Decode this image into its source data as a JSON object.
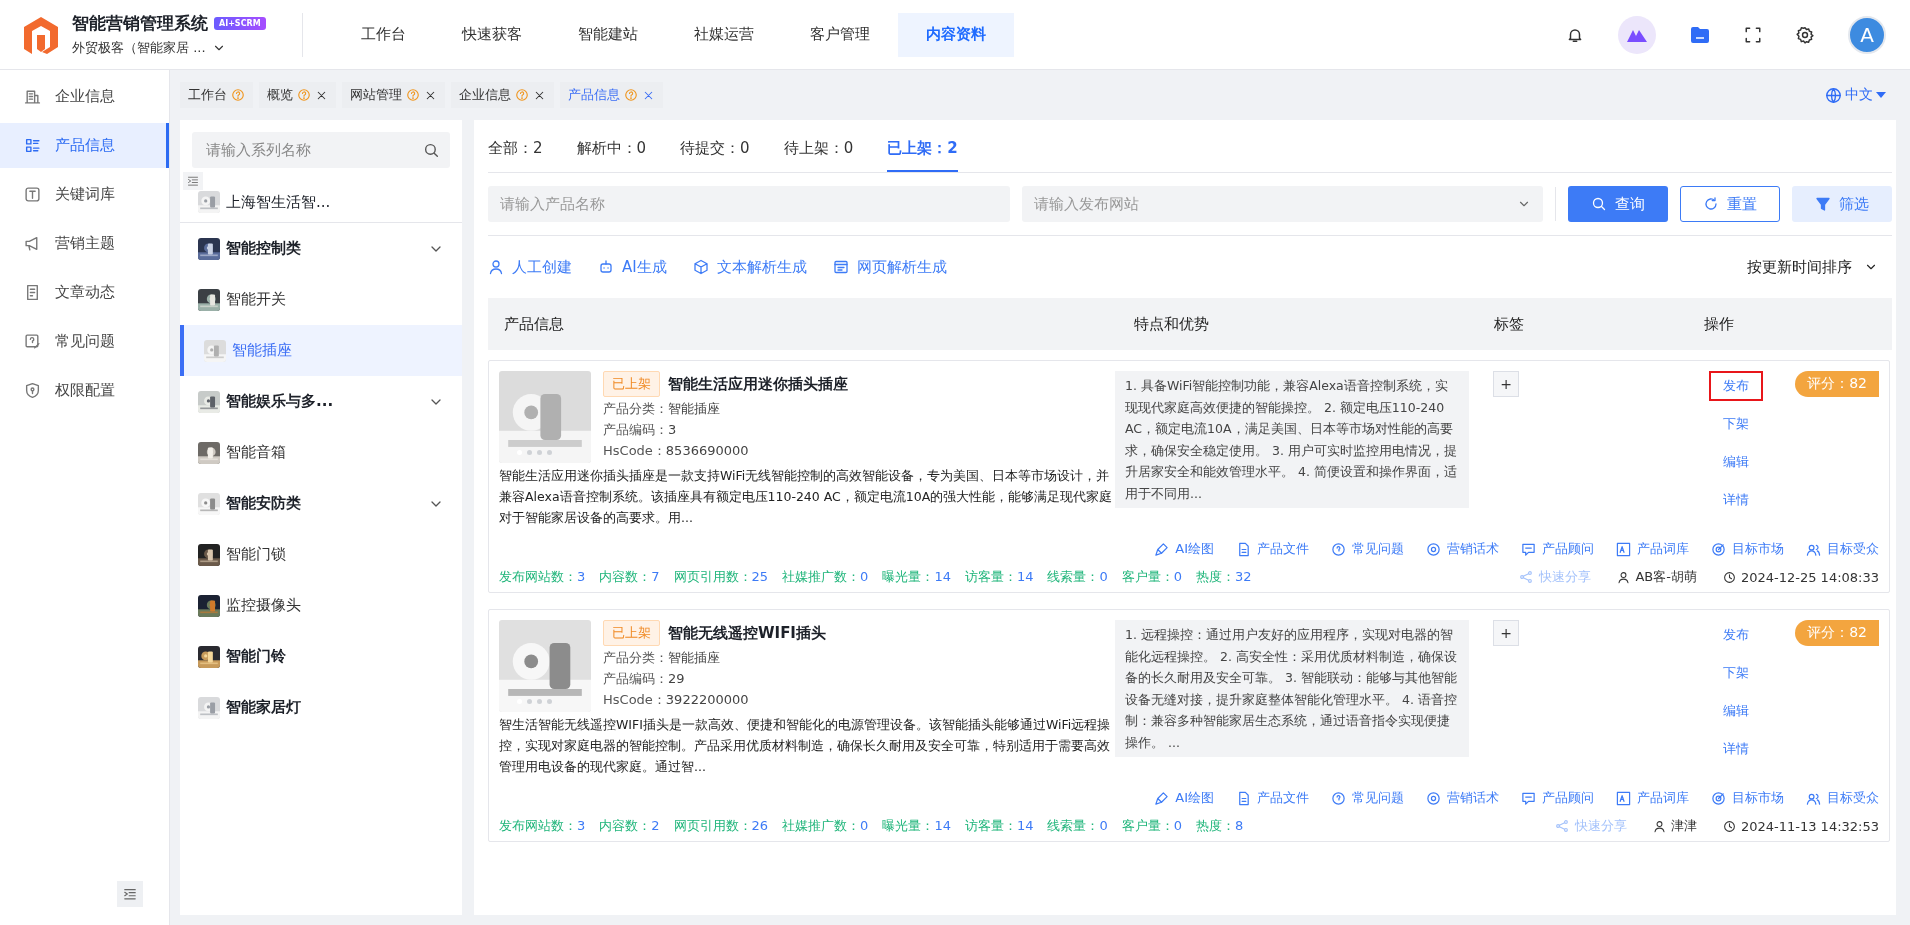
{
  "app": {
    "title": "智能营销管理系统",
    "badge": "AI+SCRM",
    "org": "外贸极客（智能家居 ...",
    "avatar": "A"
  },
  "top_nav": [
    {
      "label": "工作台",
      "selected": false
    },
    {
      "label": "快速获客",
      "selected": false
    },
    {
      "label": "智能建站",
      "selected": false
    },
    {
      "label": "社媒运营",
      "selected": false
    },
    {
      "label": "客户管理",
      "selected": false
    },
    {
      "label": "内容资料",
      "selected": true
    }
  ],
  "side_nav": [
    {
      "label": "企业信息",
      "selected": false
    },
    {
      "label": "产品信息",
      "selected": true
    },
    {
      "label": "关键词库",
      "selected": false
    },
    {
      "label": "营销主题",
      "selected": false
    },
    {
      "label": "文章动态",
      "selected": false
    },
    {
      "label": "常见问题",
      "selected": false
    },
    {
      "label": "权限配置",
      "selected": false
    }
  ],
  "page_tabs": [
    {
      "label": "工作台",
      "closable": false,
      "selected": false
    },
    {
      "label": "概览",
      "closable": true,
      "selected": false
    },
    {
      "label": "网站管理",
      "closable": true,
      "selected": false
    },
    {
      "label": "企业信息",
      "closable": true,
      "selected": false
    },
    {
      "label": "产品信息",
      "closable": true,
      "selected": true
    }
  ],
  "language": "中文",
  "category_panel": {
    "search_placeholder": "请输入系列名称",
    "company": "上海智生活智...",
    "items": [
      {
        "label": "智能控制类",
        "expanded": true,
        "children": [
          {
            "label": "智能开关",
            "selected": false
          },
          {
            "label": "智能插座",
            "selected": true
          }
        ]
      },
      {
        "label": "智能娱乐与多...",
        "expanded": true,
        "children": [
          {
            "label": "智能音箱",
            "selected": false
          }
        ]
      },
      {
        "label": "智能安防类",
        "expanded": true,
        "children": [
          {
            "label": "智能门锁",
            "selected": false
          },
          {
            "label": "监控摄像头",
            "selected": false
          }
        ]
      },
      {
        "label": "智能门铃"
      },
      {
        "label": "智能家居灯"
      }
    ]
  },
  "status_tabs": [
    {
      "label": "全部：2",
      "selected": false
    },
    {
      "label": "解析中：0",
      "selected": false
    },
    {
      "label": "待提交：0",
      "selected": false
    },
    {
      "label": "待上架：0",
      "selected": false
    },
    {
      "label": "已上架：2",
      "selected": true
    }
  ],
  "filters": {
    "name_placeholder": "请输入产品名称",
    "site_placeholder": "请输入发布网站",
    "buttons": [
      {
        "label": "查询",
        "kind": "primary"
      },
      {
        "label": "重置",
        "kind": "outline"
      },
      {
        "label": "筛选",
        "kind": "light"
      }
    ]
  },
  "create_actions": [
    "人工创建",
    "AI生成",
    "文本解析生成",
    "网页解析生成"
  ],
  "sort": "按更新时间排序",
  "table": {
    "columns": [
      "产品信息",
      "特点和优势",
      "标签",
      "操作"
    ],
    "rows": [
      {
        "status": "已上架",
        "name": "智能生活应用迷你插头插座",
        "fields": [
          {
            "label": "产品分类：",
            "value": "智能插座"
          },
          {
            "label": "产品编码：",
            "value": "3"
          },
          {
            "label": "HsCode：",
            "value": "8536690000"
          }
        ],
        "description": "智能生活应用迷你插头插座是一款支持WiFi无线智能控制的高效智能设备，专为美国、日本等市场设计，并兼容Alexa语音控制系统。该插座具有额定电压110-240 AC，额定电流10A的强大性能，能够满足现代家庭对于智能家居设备的高要求。用...",
        "features": "1. 具备WiFi智能控制功能，兼容Alexa语音控制系统，实现现代家庭高效便捷的智能操控。 2. 额定电压110-240 AC，额定电流10A，满足美国、日本等市场对性能的高要求，确保安全稳定使用。 3. 用户可实时监控用电情况，提升居家安全和能效管理水平。 4. 简便设置和操作界面，适用于不同用...",
        "tag_button": "+",
        "actions": [
          {
            "label": "发布",
            "highlighted": true
          },
          {
            "label": "下架",
            "highlighted": false
          },
          {
            "label": "编辑",
            "highlighted": false
          },
          {
            "label": "详情",
            "highlighted": false
          }
        ],
        "score": "评分：82",
        "tools": [
          "AI绘图",
          "产品文件",
          "常见问题",
          "营销话术",
          "产品顾问",
          "产品词库",
          "目标市场",
          "目标受众"
        ],
        "stats": [
          {
            "label": "发布网站数：",
            "value": "3"
          },
          {
            "label": "内容数：",
            "value": "7"
          },
          {
            "label": "网页引用数：",
            "value": "25"
          },
          {
            "label": "社媒推广数：",
            "value": "0"
          },
          {
            "label": "曝光量：",
            "value": "14"
          },
          {
            "label": "访客量：",
            "value": "14"
          },
          {
            "label": "线索量：",
            "value": "0"
          },
          {
            "label": "客户量：",
            "value": "0"
          },
          {
            "label": "热度：",
            "value": "32"
          }
        ],
        "share": "快速分享",
        "owner": "AB客-胡萌",
        "time": "2024-12-25 14:08:33"
      },
      {
        "status": "已上架",
        "name": "智能无线遥控WIFI插头",
        "fields": [
          {
            "label": "产品分类：",
            "value": "智能插座"
          },
          {
            "label": "产品编码：",
            "value": "29"
          },
          {
            "label": "HsCode：",
            "value": "3922200000"
          }
        ],
        "description": "智生活智能无线遥控WIFI插头是一款高效、便捷和智能化的电源管理设备。该智能插头能够通过WiFi远程操控，实现对家庭电器的智能控制。产品采用优质材料制造，确保长久耐用及安全可靠，特别适用于需要高效管理用电设备的现代家庭。通过智...",
        "features": "1. 远程操控：通过用户友好的应用程序，实现对电器的智能化远程操控。 2. 高安全性：采用优质材料制造，确保设备的长久耐用及安全可靠。 3. 智能联动：能够与其他智能设备无缝对接，提升家庭整体智能化管理水平。 4. 语音控制：兼容多种智能家居生态系统，通过语音指令实现便捷操作。 ...",
        "tag_button": "+",
        "actions": [
          {
            "label": "发布",
            "highlighted": false
          },
          {
            "label": "下架",
            "highlighted": false
          },
          {
            "label": "编辑",
            "highlighted": false
          },
          {
            "label": "详情",
            "highlighted": false
          }
        ],
        "score": "评分：82",
        "tools": [
          "AI绘图",
          "产品文件",
          "常见问题",
          "营销话术",
          "产品顾问",
          "产品词库",
          "目标市场",
          "目标受众"
        ],
        "stats": [
          {
            "label": "发布网站数：",
            "value": "3"
          },
          {
            "label": "内容数：",
            "value": "2"
          },
          {
            "label": "网页引用数：",
            "value": "26"
          },
          {
            "label": "社媒推广数：",
            "value": "0"
          },
          {
            "label": "曝光量：",
            "value": "14"
          },
          {
            "label": "访客量：",
            "value": "14"
          },
          {
            "label": "线索量：",
            "value": "0"
          },
          {
            "label": "客户量：",
            "value": "0"
          },
          {
            "label": "热度：",
            "value": "8"
          }
        ],
        "share": "快速分享",
        "owner": "津津",
        "time": "2024-11-13 14:32:53"
      }
    ]
  }
}
